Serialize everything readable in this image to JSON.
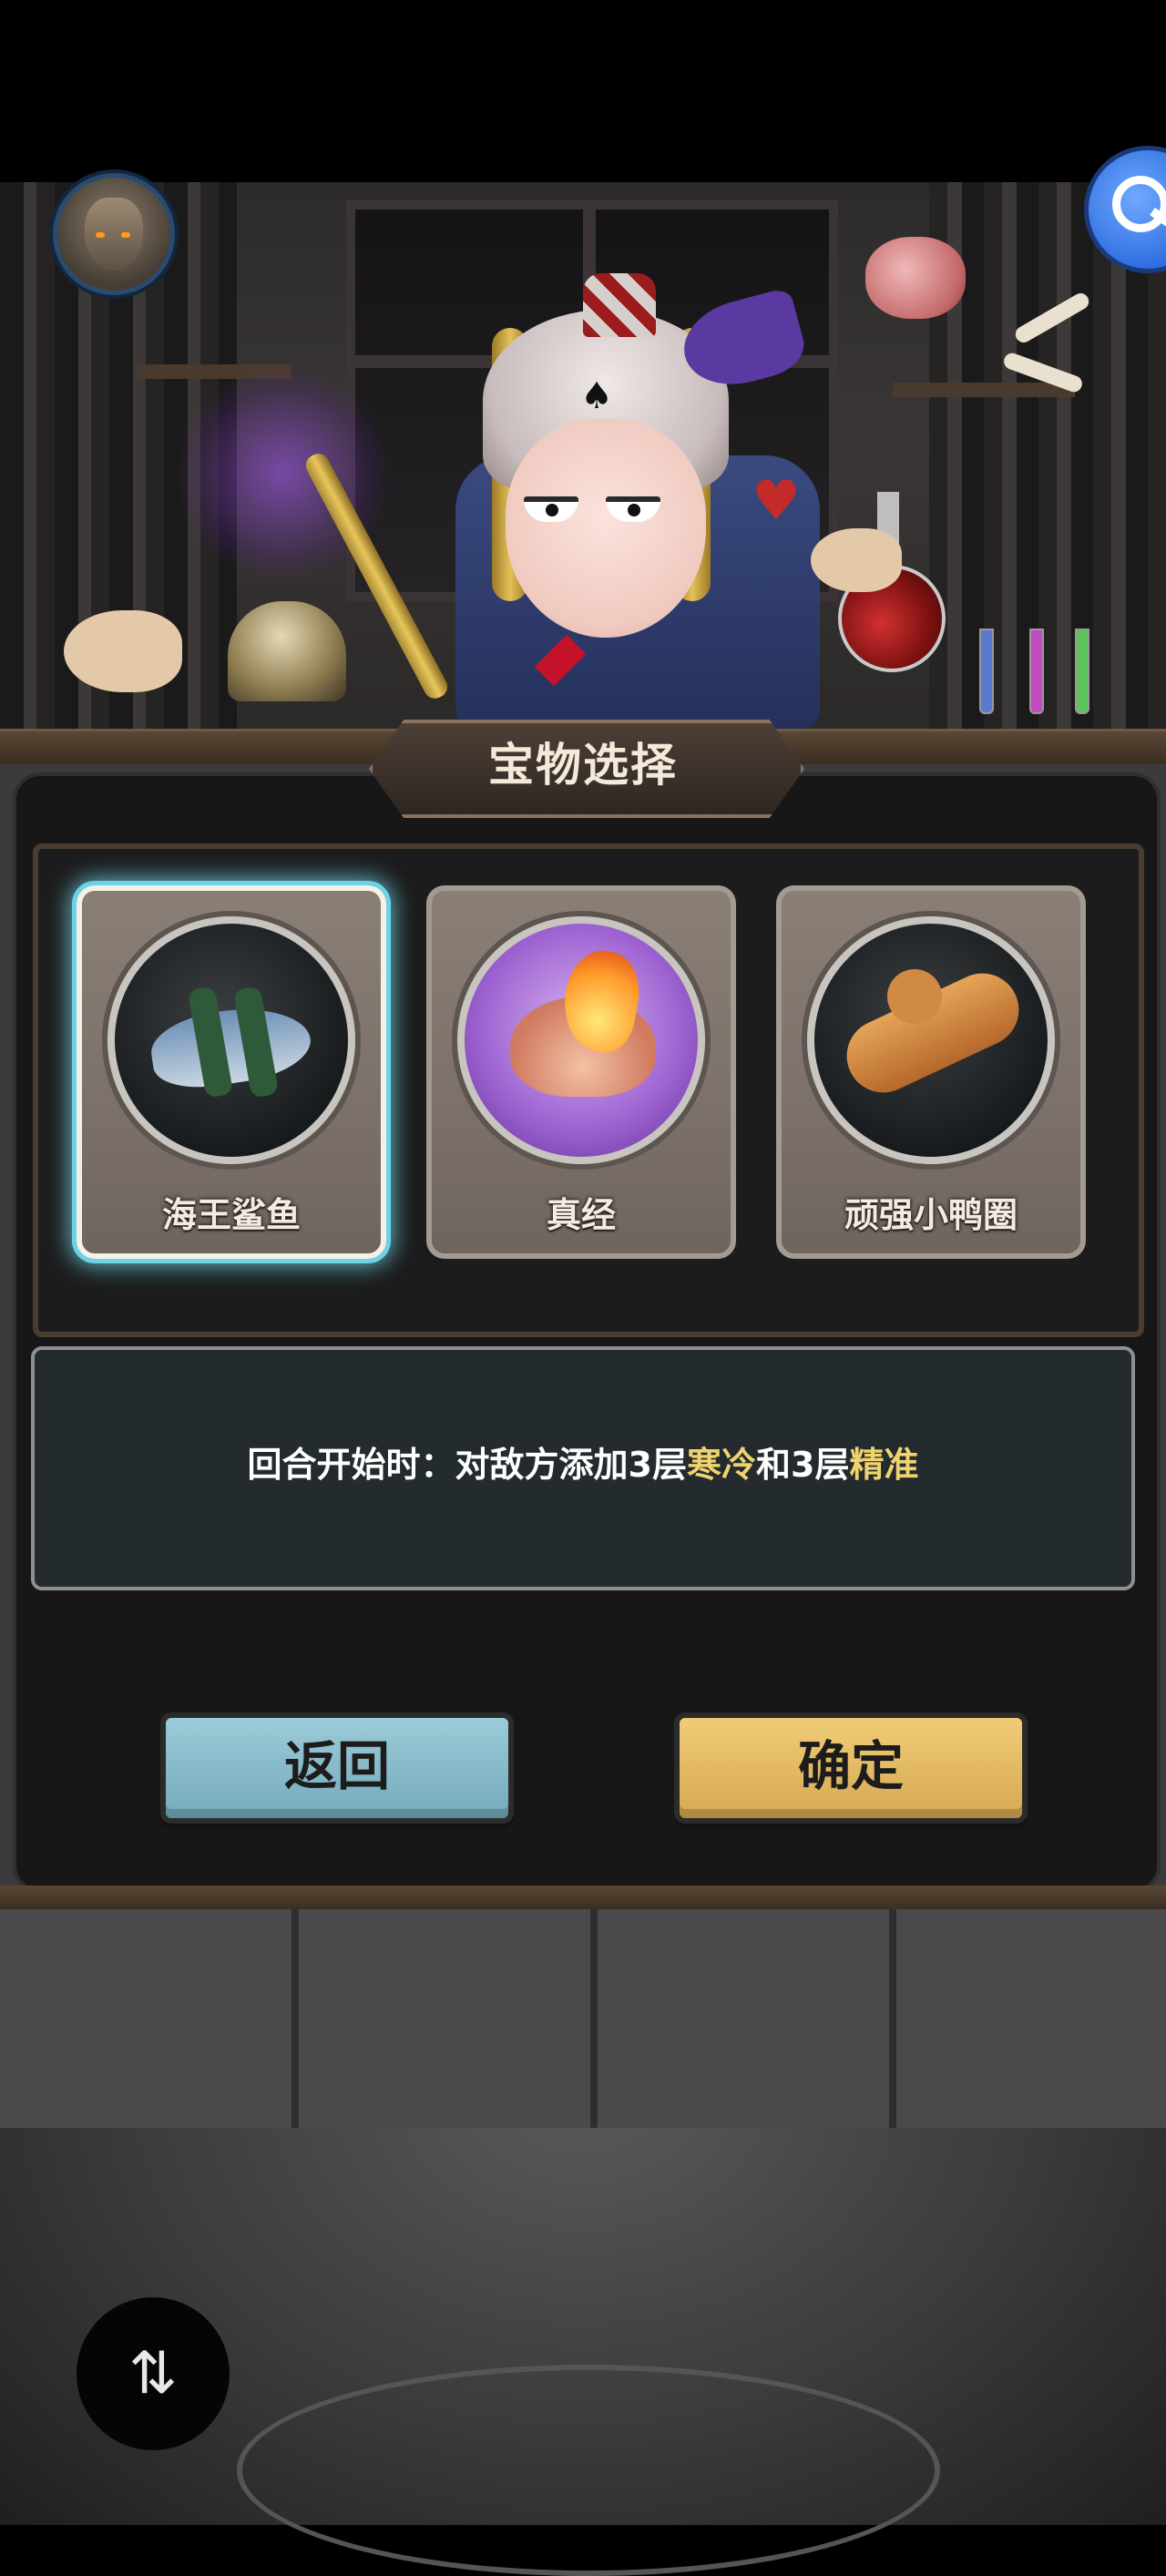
{
  "dialog": {
    "title": "宝物选择",
    "items": [
      {
        "name": "海王鲨鱼",
        "selected": true
      },
      {
        "name": "真经",
        "selected": false
      },
      {
        "name": "顽强小鸭圈",
        "selected": false
      }
    ],
    "description": {
      "prefix": "回合开始时：对敌方添加3层",
      "keyword1": "寒冷",
      "middle": "和3层",
      "keyword2": "精准"
    },
    "buttons": {
      "back": "返回",
      "confirm": "确定"
    }
  },
  "hud": {
    "avatar_icon": "hero-portrait",
    "key_icon": "key-icon",
    "float_icon": "rotate-icon"
  },
  "colors": {
    "selection_glow": "#6fd1e6",
    "keyword": "#f0d36e",
    "back_button": "#8fc2d1",
    "confirm_button": "#e7bf69"
  }
}
